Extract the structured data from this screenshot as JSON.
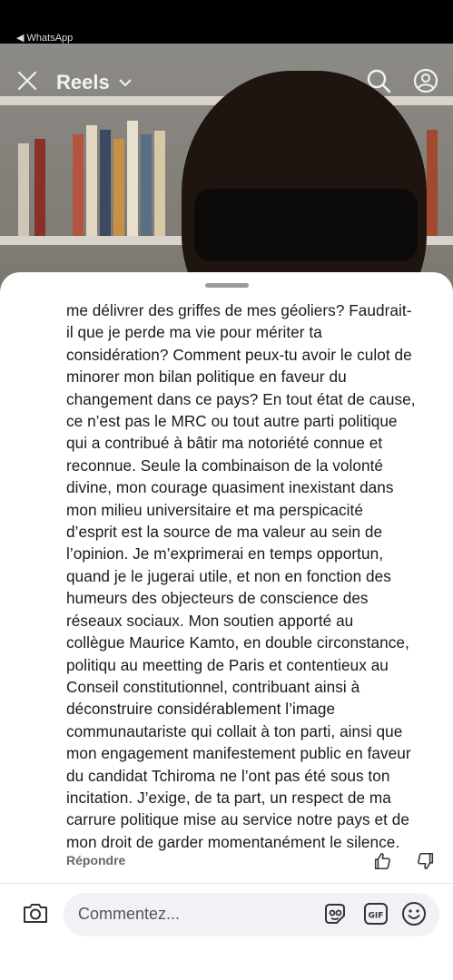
{
  "status_bar": {
    "back_label": "◀ WhatsApp"
  },
  "header": {
    "title": "Reels",
    "icons": [
      "close-icon",
      "chevron-down-icon",
      "search-icon",
      "profile-icon"
    ]
  },
  "comment": {
    "lines": [
      "me délivrer des griffes de mes géoliers? Faudrait-",
      "il que je perde ma vie pour mériter ta",
      "considération? Comment peux-tu avoir le culot de",
      "minorer mon bilan politique en faveur du",
      "changement dans ce pays? En tout état de cause,",
      "ce n’est pas le MRC ou tout autre parti politique",
      "qui a contribué à bâtir ma notoriété connue et",
      "reconnue. Seule la combinaison de la volonté",
      "divine, mon courage quasiment inexistant dans",
      "mon milieu universitaire et ma perspicacité",
      "d’esprit est la source de ma valeur au sein de",
      "l’opinion. Je m’exprimerai en temps opportun,",
      "quand je le jugerai utile, et non en fonction des",
      "humeurs des objecteurs de conscience des",
      "réseaux sociaux. Mon soutien apporté au",
      "collègue Maurice Kamto, en double circonstance,",
      "politiqu au meetting de Paris et contentieux au",
      "Conseil constitutionnel, contribuant ainsi à",
      "déconstruire considérablement l’image",
      "communautariste qui collait à ton parti, ainsi que",
      "mon engagement manifestement public en faveur",
      "du candidat Tchiroma ne l’ont pas été sous ton",
      "incitation. J’exige, de ta part, un respect de ma",
      "carrure politique mise au service notre pays et de",
      "mon droit de garder momentanément le silence."
    ],
    "reply_label": "Répondre"
  },
  "composer": {
    "placeholder": "Commentez..."
  },
  "colors": {
    "sheet_bg": "#ffffff",
    "input_bg": "#f0f2f5",
    "text": "#1a1a1a",
    "muted": "#666666"
  }
}
